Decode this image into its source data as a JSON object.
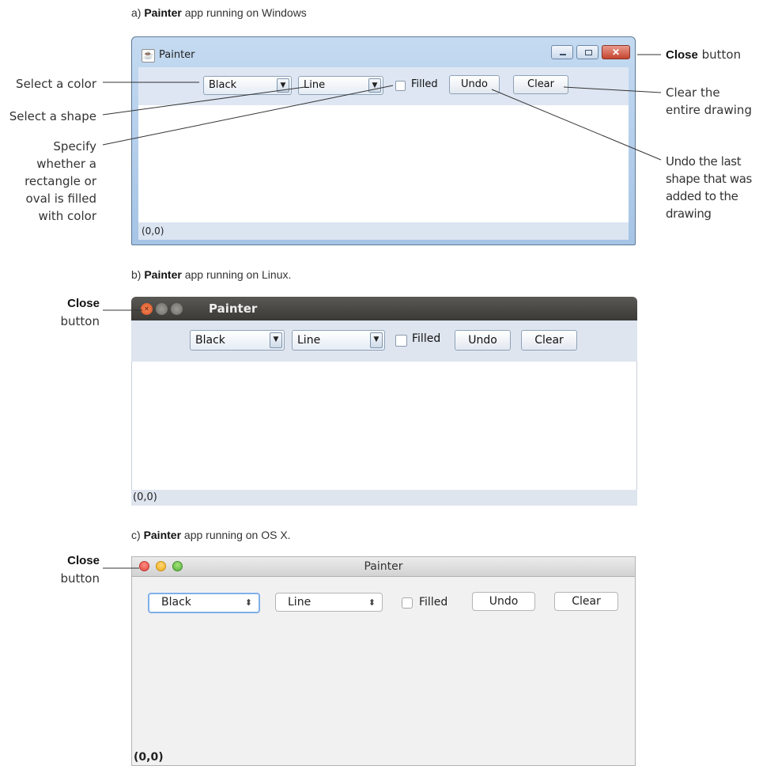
{
  "captions": {
    "a": {
      "label": "a)",
      "app": "Painter",
      "rest": "app running on Windows"
    },
    "b": {
      "label": "b)",
      "app": "Painter",
      "rest": "app running on Linux."
    },
    "c": {
      "label": "c)",
      "app": "Painter",
      "rest": "app running on OS X."
    }
  },
  "annotations": {
    "select_color": "Select a color",
    "select_shape": "Select a shape",
    "specify_filled": [
      "Specify",
      "whether a",
      "rectangle or",
      "oval is filled",
      "with color"
    ],
    "close_win": {
      "bold": "Close",
      "rest": "button"
    },
    "clear_drawing": [
      "Clear the",
      "entire drawing"
    ],
    "undo_shape": [
      "Undo the last",
      "shape that was",
      "added to the",
      "drawing"
    ],
    "close_linux": {
      "bold": "Close",
      "rest": "button"
    },
    "close_osx": {
      "bold": "Close",
      "rest": "button"
    }
  },
  "windows_app": {
    "title": "Painter",
    "color_selected": "Black",
    "shape_selected": "Line",
    "filled_label": "Filled",
    "undo_label": "Undo",
    "clear_label": "Clear",
    "status": "(0,0)"
  },
  "linux_app": {
    "title": "Painter",
    "color_selected": "Black",
    "shape_selected": "Line",
    "filled_label": "Filled",
    "undo_label": "Undo",
    "clear_label": "Clear",
    "status": "(0,0)"
  },
  "osx_app": {
    "title": "Painter",
    "color_selected": "Black",
    "shape_selected": "Line",
    "filled_label": "Filled",
    "undo_label": "Undo",
    "clear_label": "Clear",
    "status": "(0,0)"
  },
  "colors": {
    "windows_frame": "#a6c4e6",
    "linux_titlebar": "#3a3935",
    "osx_close": "#e2463b",
    "osx_minimize": "#f0aa1c",
    "osx_zoom": "#55b33a"
  },
  "icons": {
    "windows_title": "java-cup-icon",
    "dropdown": "triangle-down-icon",
    "osx_select": "up-down-arrows-icon"
  }
}
